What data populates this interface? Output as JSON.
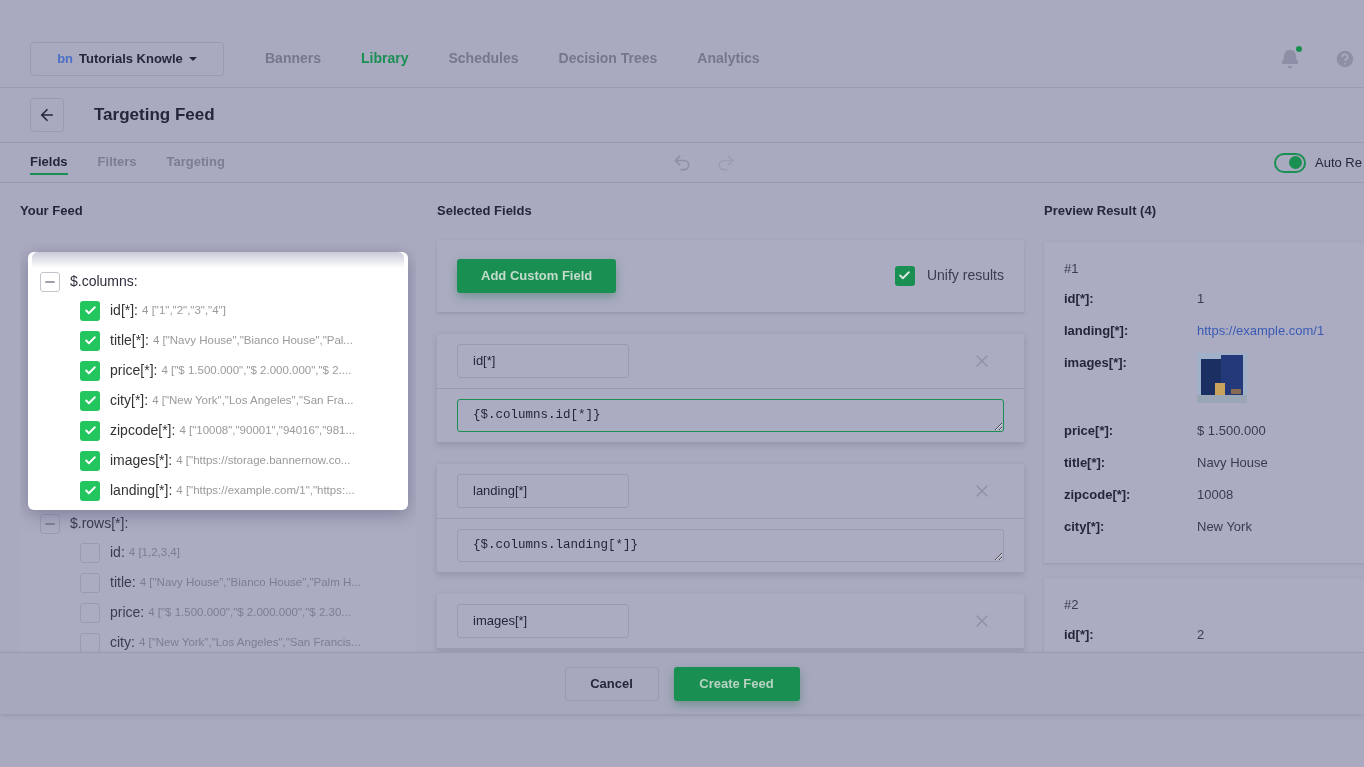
{
  "header": {
    "org": {
      "logo": "bn",
      "name": "Tutorials Knowle"
    },
    "nav": [
      {
        "label": "Banners",
        "selected": false
      },
      {
        "label": "Library",
        "selected": true
      },
      {
        "label": "Schedules",
        "selected": false
      },
      {
        "label": "Decision Trees",
        "selected": false
      },
      {
        "label": "Analytics",
        "selected": false
      }
    ],
    "notifications": {
      "unread": true
    }
  },
  "page": {
    "title": "Targeting Feed"
  },
  "tabs": [
    {
      "label": "Fields",
      "selected": true
    },
    {
      "label": "Filters",
      "selected": false
    },
    {
      "label": "Targeting",
      "selected": false
    }
  ],
  "auto_refresh": {
    "label": "Auto Re",
    "on": true
  },
  "your_feed": {
    "title": "Your Feed",
    "groups": [
      {
        "label": "$.columns:",
        "indeterminate": true,
        "highlighted": true,
        "children": [
          {
            "name": "id[*]:",
            "count": "4",
            "preview": "[\"1\",\"2\",\"3\",\"4\"]",
            "checked": true
          },
          {
            "name": "title[*]:",
            "count": "4",
            "preview": "[\"Navy House\",\"Bianco House\",\"Pal...",
            "checked": true
          },
          {
            "name": "price[*]:",
            "count": "4",
            "preview": "[\"$ 1.500.000\",\"$ 2.000.000\",\"$ 2....",
            "checked": true
          },
          {
            "name": "city[*]:",
            "count": "4",
            "preview": "[\"New York\",\"Los Angeles\",\"San Fra...",
            "checked": true
          },
          {
            "name": "zipcode[*]:",
            "count": "4",
            "preview": "[\"10008\",\"90001\",\"94016\",\"981...",
            "checked": true
          },
          {
            "name": "images[*]:",
            "count": "4",
            "preview": "[\"https://storage.bannernow.co...",
            "checked": true
          },
          {
            "name": "landing[*]:",
            "count": "4",
            "preview": "[\"https://example.com/1\",\"https:...",
            "checked": true
          }
        ]
      },
      {
        "label": "$.rows[*]:",
        "indeterminate": true,
        "highlighted": false,
        "children": [
          {
            "name": "id:",
            "count": "4",
            "preview": "[1,2,3,4]",
            "checked": false
          },
          {
            "name": "title:",
            "count": "4",
            "preview": "[\"Navy House\",\"Bianco House\",\"Palm H...",
            "checked": false
          },
          {
            "name": "price:",
            "count": "4",
            "preview": "[\"$ 1.500.000\",\"$ 2.000.000\",\"$ 2.30...",
            "checked": false
          },
          {
            "name": "city:",
            "count": "4",
            "preview": "[\"New York\",\"Los Angeles\",\"San Francis...",
            "checked": false
          }
        ]
      }
    ]
  },
  "selected_fields": {
    "title": "Selected Fields",
    "add_button": "Add Custom Field",
    "unify": {
      "label": "Unify results",
      "checked": true
    },
    "fields": [
      {
        "name": "id[*]",
        "expression": "{$.columns.id[*]}",
        "focused": true
      },
      {
        "name": "landing[*]",
        "expression": "{$.columns.landing[*]}",
        "focused": false
      },
      {
        "name": "images[*]"
      }
    ]
  },
  "preview": {
    "title": "Preview Result (4)",
    "results": [
      {
        "number": "#1",
        "rows": [
          {
            "key": "id[*]:",
            "kind": "text",
            "value": "1"
          },
          {
            "key": "landing[*]:",
            "kind": "link",
            "value": "https://example.com/1"
          },
          {
            "key": "images[*]:"
          },
          {
            "key": "price[*]:",
            "kind": "text",
            "value": "$ 1.500.000"
          },
          {
            "key": "title[*]:",
            "kind": "text",
            "value": "Navy House"
          },
          {
            "key": "zipcode[*]:",
            "kind": "text",
            "value": "10008"
          },
          {
            "key": "city[*]:",
            "kind": "text",
            "value": "New York"
          }
        ]
      },
      {
        "number": "#2",
        "rows": [
          {
            "key": "id[*]:",
            "kind": "text",
            "value": "2"
          }
        ]
      }
    ]
  },
  "footer": {
    "cancel": "Cancel",
    "create": "Create Feed"
  }
}
